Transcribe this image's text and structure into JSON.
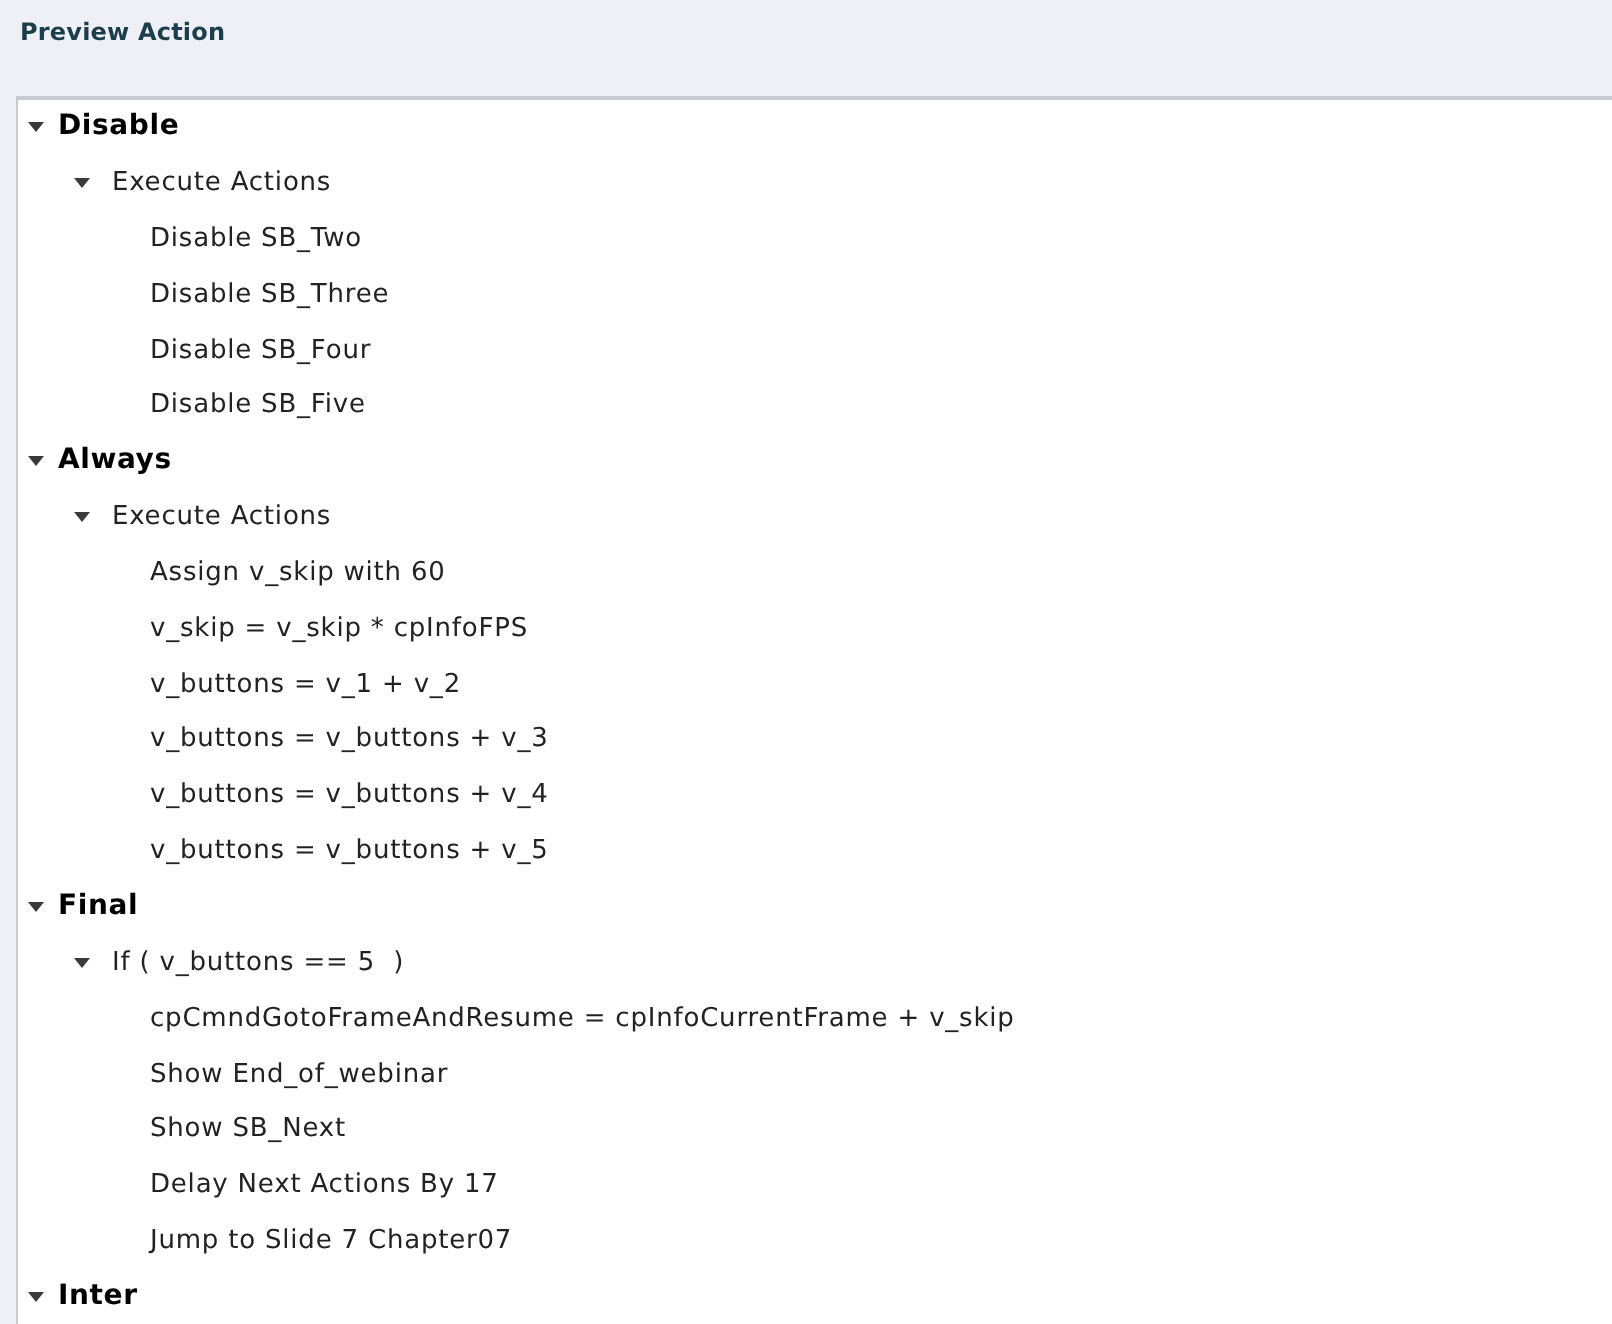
{
  "title": "Preview Action",
  "tree": [
    {
      "label": "Disable",
      "expanded": true,
      "children": [
        {
          "label": "Execute Actions",
          "expanded": true,
          "children": [
            {
              "label": "Disable SB_Two"
            },
            {
              "label": "Disable SB_Three"
            },
            {
              "label": "Disable SB_Four"
            },
            {
              "label": "Disable SB_Five"
            }
          ]
        }
      ]
    },
    {
      "label": "Always",
      "expanded": true,
      "children": [
        {
          "label": "Execute Actions",
          "expanded": true,
          "children": [
            {
              "label": "Assign v_skip with 60"
            },
            {
              "label": "v_skip = v_skip * cpInfoFPS"
            },
            {
              "label": "v_buttons = v_1 + v_2"
            },
            {
              "label": "v_buttons = v_buttons + v_3"
            },
            {
              "label": "v_buttons = v_buttons + v_4"
            },
            {
              "label": "v_buttons = v_buttons + v_5"
            }
          ]
        }
      ]
    },
    {
      "label": "Final",
      "expanded": true,
      "children": [
        {
          "label": "If ( v_buttons == 5  )",
          "expanded": true,
          "children": [
            {
              "label": "cpCmndGotoFrameAndResume = cpInfoCurrentFrame + v_skip"
            },
            {
              "label": "Show End_of_webinar"
            },
            {
              "label": "Show SB_Next"
            },
            {
              "label": "Delay Next Actions By 17"
            },
            {
              "label": "Jump to Slide 7 Chapter07"
            }
          ]
        }
      ]
    },
    {
      "label": "Inter",
      "expanded": true
    }
  ]
}
